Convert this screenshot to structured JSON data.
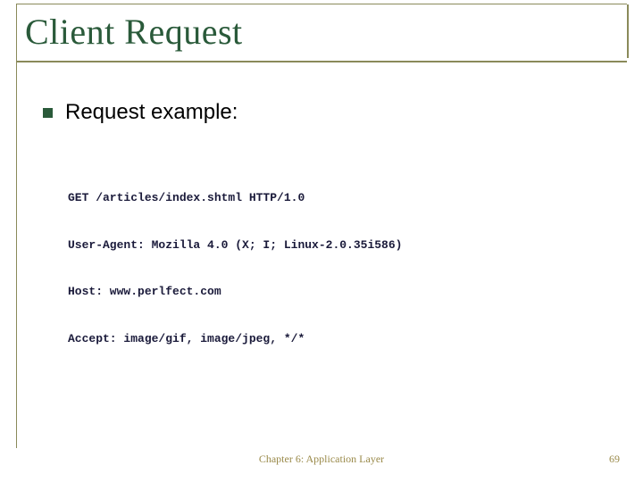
{
  "title": "Client Request",
  "bullet_text": "Request example:",
  "code_lines": [
    "GET /articles/index.shtml HTTP/1.0",
    "User-Agent: Mozilla 4.0 (X; I; Linux-2.0.35i586)",
    "Host: www.perlfect.com",
    "Accept: image/gif, image/jpeg, */*"
  ],
  "footer": {
    "center": "Chapter 6: Application Layer",
    "page": "69"
  }
}
